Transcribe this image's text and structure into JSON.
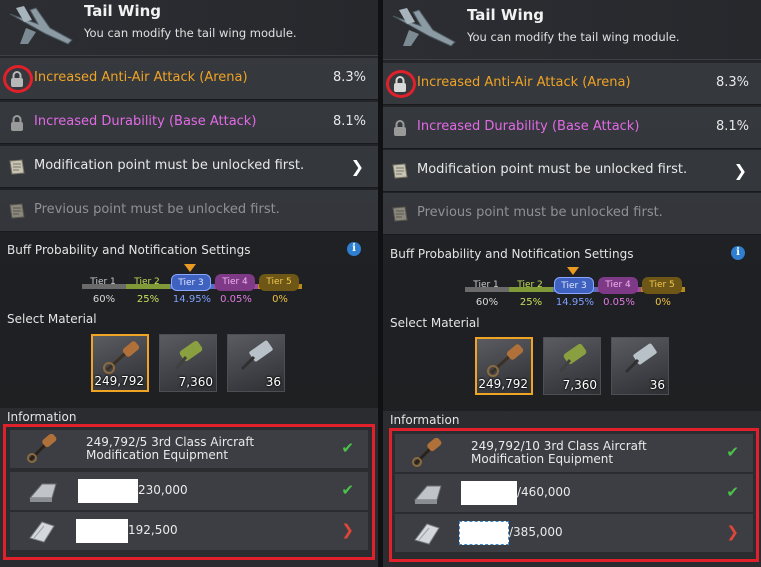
{
  "left": {
    "header": {
      "title": "Tail Wing",
      "subtitle": "You can modify the tail wing module."
    },
    "options": [
      {
        "label": "Increased Anti-Air Attack (Arena)",
        "value": "8.3%",
        "icon": "lock-icon"
      },
      {
        "label": "Increased Durability (Base Attack)",
        "value": "8.1%",
        "icon": "lock-icon"
      },
      {
        "label": "Modification point must be unlocked first.",
        "icon": "scroll-icon"
      },
      {
        "label": "Previous point must be unlocked first.",
        "icon": "scroll-icon"
      }
    ],
    "buff_heading": "Buff Probability and Notification Settings",
    "tiers": [
      {
        "name": "Tier 1",
        "pct": "60%",
        "color": "#9a9a9a"
      },
      {
        "name": "Tier 2",
        "pct": "25%",
        "color": "#b8d84a"
      },
      {
        "name": "Tier 3",
        "pct": "14.95%",
        "color": "#5b82e0"
      },
      {
        "name": "Tier 4",
        "pct": "0.05%",
        "color": "#d862d8"
      },
      {
        "name": "Tier 5",
        "pct": "0%",
        "color": "#e8b21c"
      }
    ],
    "select_material": "Select Material",
    "materials": [
      "249,792",
      "7,360",
      "36"
    ],
    "information": "Information",
    "info_rows": [
      {
        "line1": "249,792/5 3rd Class Aircraft",
        "line2": "Modification Equipment",
        "status": "check"
      },
      {
        "amount": "230,000",
        "status": "check"
      },
      {
        "amount": "192,500",
        "status": "chevron"
      }
    ]
  },
  "right": {
    "header": {
      "title": "Tail Wing",
      "subtitle": "You can modify the tail wing module."
    },
    "options": [
      {
        "label": "Increased Anti-Air Attack (Arena)",
        "value": "8.3%",
        "icon": "lock-icon"
      },
      {
        "label": "Increased Durability (Base Attack)",
        "value": "8.1%",
        "icon": "lock-icon"
      },
      {
        "label": "Modification point must be unlocked first.",
        "icon": "scroll-icon"
      },
      {
        "label": "Previous point must be unlocked first.",
        "icon": "scroll-icon"
      }
    ],
    "buff_heading": "Buff Probability and Notification Settings",
    "tiers": [
      {
        "name": "Tier 1",
        "pct": "60%"
      },
      {
        "name": "Tier 2",
        "pct": "25%"
      },
      {
        "name": "Tier 3",
        "pct": "14.95%"
      },
      {
        "name": "Tier 4",
        "pct": "0.05%"
      },
      {
        "name": "Tier 5",
        "pct": "0%"
      }
    ],
    "select_material": "Select Material",
    "materials": [
      "249,792",
      "7,360",
      "36"
    ],
    "information": "Information",
    "info_rows": [
      {
        "line1": "249,792/10 3rd Class Aircraft",
        "line2": "Modification Equipment",
        "status": "check"
      },
      {
        "amount": "/460,000",
        "status": "check"
      },
      {
        "amount": "/385,000",
        "status": "chevron"
      }
    ]
  },
  "colors": {
    "highlight_red": "#e0202a",
    "selected_orange": "#f0a424",
    "check_green": "#4cc24a"
  }
}
